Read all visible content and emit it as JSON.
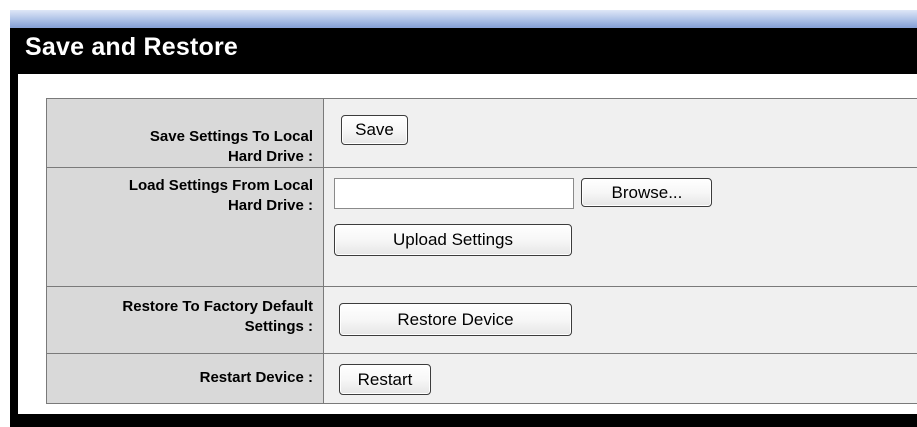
{
  "header": {
    "title": "Save and Restore"
  },
  "rows": [
    {
      "label_line1": "Save Settings To Local",
      "label_line2": "Hard Drive :",
      "save_label": "Save"
    },
    {
      "label_line1": "Load Settings From Local",
      "label_line2": "Hard Drive :",
      "file_value": "",
      "browse_label": "Browse...",
      "upload_label": "Upload Settings"
    },
    {
      "label_line1": "Restore To Factory Default",
      "label_line2": "Settings :",
      "restore_label": "Restore Device"
    },
    {
      "label_line1": "Restart Device :",
      "restart_label": "Restart"
    }
  ],
  "colors": {
    "header_bg": "#000000",
    "label_cell_bg": "#d9d9d9",
    "control_cell_bg": "#f0f0f0",
    "top_stripe": "#8aa4d8"
  }
}
